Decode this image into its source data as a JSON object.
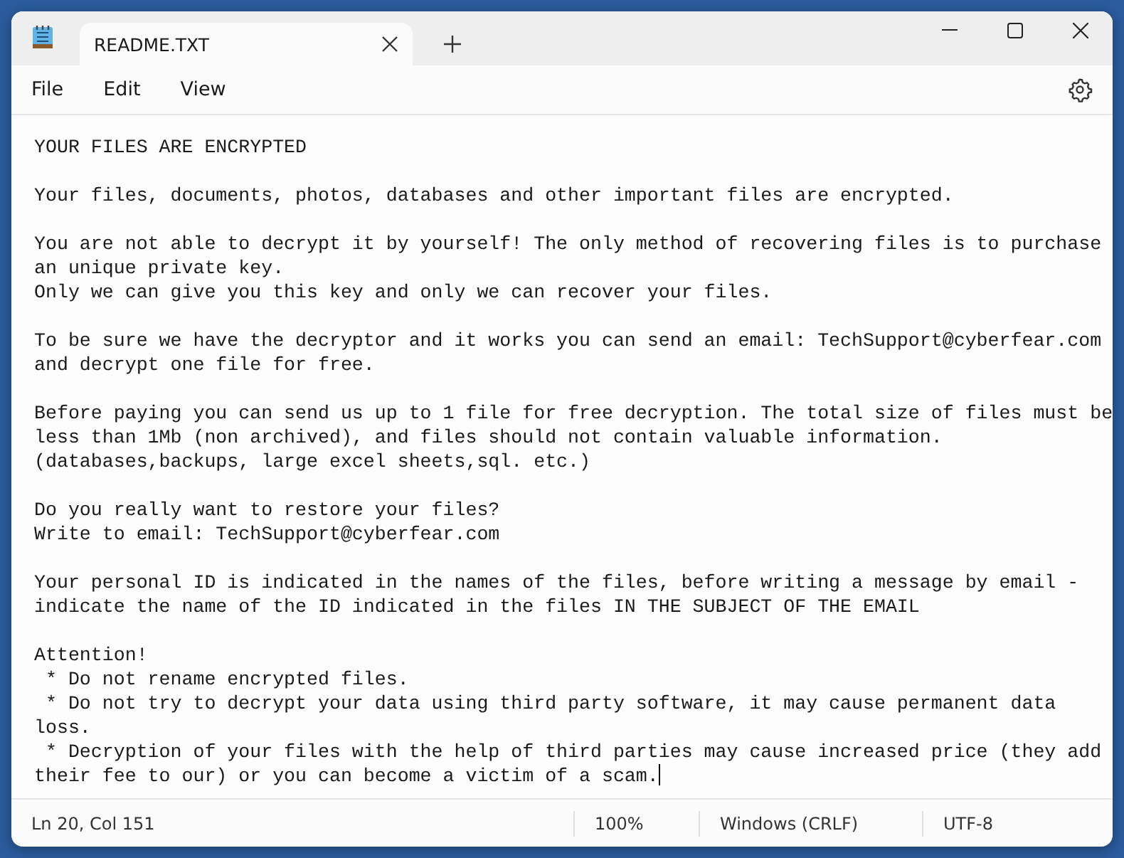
{
  "tabs": [
    {
      "title": "README.TXT",
      "selected": true
    }
  ],
  "menu": [
    "File",
    "Edit",
    "View"
  ],
  "document": {
    "blocks": [
      [
        "YOUR FILES ARE ENCRYPTED"
      ],
      [
        "Your files, documents, photos, databases and other important files are encrypted."
      ],
      [
        "You are not able to decrypt it by yourself! The only method of recovering files is to purchase",
        "an unique private key.",
        "Only we can give you this key and only we can recover your files."
      ],
      [
        "To be sure we have the decryptor and it works you can send an email: TechSupport@cyberfear.com",
        "and decrypt one file for free."
      ],
      [
        "Before paying you can send us up to 1 file for free decryption. The total size of files must be",
        "less than 1Mb (non archived), and files should not contain valuable information.",
        "(databases,backups, large excel sheets,sql. etc.)"
      ],
      [
        "Do you really want to restore your files?",
        "Write to email: TechSupport@cyberfear.com"
      ],
      [
        "Your personal ID is indicated in the names of the files, before writing a message by email -",
        "indicate the name of the ID indicated in the files IN THE SUBJECT OF THE EMAIL"
      ],
      [
        "Attention!",
        " * Do not rename encrypted files.",
        " * Do not try to decrypt your data using third party software, it may cause permanent data",
        "loss.",
        " * Decryption of your files with the help of third parties may cause increased price (they add",
        "their fee to our) or you can become a victim of a scam."
      ]
    ]
  },
  "status_bar": [
    "Ln 20, Col 151",
    "100%",
    "Windows (CRLF)",
    "UTF-8"
  ]
}
